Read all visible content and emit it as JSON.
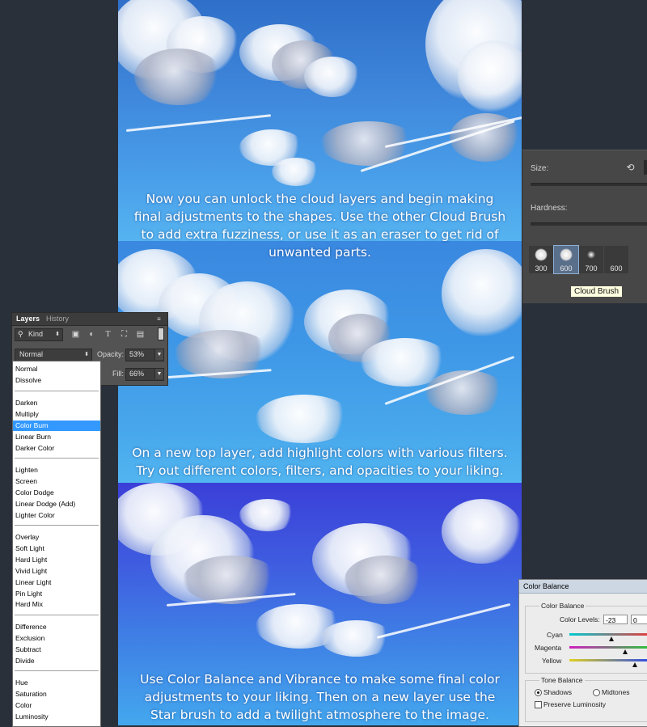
{
  "captions": {
    "first": [
      "Now you can unlock the cloud layers and begin making",
      "final adjustments to the shapes. Use the other Cloud Brush",
      "to add extra fuzziness, or use it as an eraser to get rid of",
      "unwanted parts."
    ],
    "second": [
      "On a new top layer, add highlight colors with various filters.",
      "Try out different colors, filters, and opacities to your liking."
    ],
    "third": [
      "Use Color Balance and Vibrance to make some final color",
      "adjustments to your liking. Then on a new layer use the",
      "Star brush to add a twilight atmosphere to the image."
    ]
  },
  "brush_panel": {
    "size_label": "Size:",
    "hardness_label": "Hardness:",
    "tiles": [
      {
        "num": "300"
      },
      {
        "num": "600"
      },
      {
        "num": "700"
      },
      {
        "num": "600"
      }
    ],
    "tooltip": "Cloud Brush"
  },
  "layers_panel": {
    "tabs": [
      "Layers",
      "History"
    ],
    "kind_label": "Kind",
    "blend_mode": "Normal",
    "opacity_label": "Opacity:",
    "opacity_value": "53%",
    "fill_label": "Fill:",
    "fill_value": "66%"
  },
  "blend_menu": {
    "groups": [
      [
        "Normal",
        "Dissolve"
      ],
      [
        "Darken",
        "Multiply",
        "Color Burn",
        "Linear Burn",
        "Darker Color"
      ],
      [
        "Lighten",
        "Screen",
        "Color Dodge",
        "Linear Dodge (Add)",
        "Lighter Color"
      ],
      [
        "Overlay",
        "Soft Light",
        "Hard Light",
        "Vivid Light",
        "Linear Light",
        "Pin Light",
        "Hard Mix"
      ],
      [
        "Difference",
        "Exclusion",
        "Subtract",
        "Divide"
      ],
      [
        "Hue",
        "Saturation",
        "Color",
        "Luminosity"
      ]
    ],
    "selected": "Color Burn"
  },
  "color_balance": {
    "title": "Color Balance",
    "group_title": "Color Balance",
    "levels_label": "Color Levels:",
    "level1": "-23",
    "level2": "0",
    "cyan_label": "Cyan",
    "magenta_label": "Magenta",
    "yellow_label": "Yellow",
    "tone_title": "Tone Balance",
    "shadows_label": "Shadows",
    "midtones_label": "Midtones",
    "preserve_label": "Preserve Luminosity"
  }
}
